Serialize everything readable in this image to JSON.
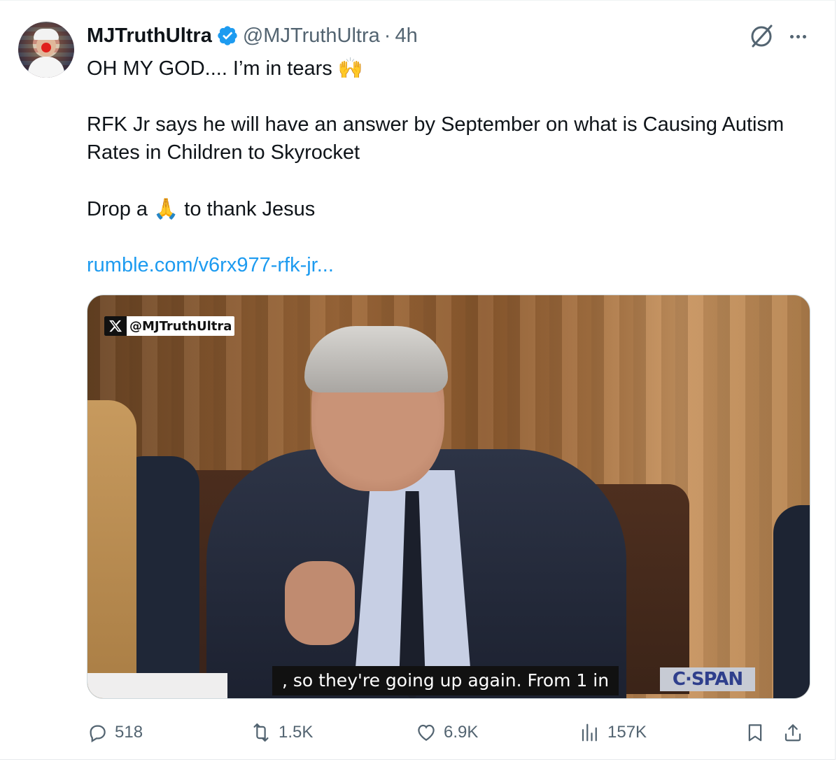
{
  "tweet": {
    "author_name": "MJTruthUltra",
    "handle": "@MJTruthUltra",
    "separator": "·",
    "time": "4h",
    "lines": {
      "line1": "OH MY GOD.... I’m in tears ",
      "line1_emoji": "🙌",
      "line2": "RFK Jr says he will have an answer by September on what is Causing Autism Rates in Children to Skyrocket",
      "line3_pre": "Drop a ",
      "line3_emoji": "🙏",
      "line3_post": " to thank Jesus",
      "link": "rumble.com/v6rx977-rfk-jr..."
    }
  },
  "media": {
    "watermark": "@MJTruthUltra",
    "caption": ", so they're going up again. From 1 in",
    "network_logo": "C·SPAN"
  },
  "actions": {
    "replies": "518",
    "reposts": "1.5K",
    "likes": "6.9K",
    "views": "157K"
  },
  "colors": {
    "link": "#1d9bf0",
    "muted": "#536471",
    "verified": "#1d9bf0"
  },
  "icons": [
    "verified-badge-icon",
    "grok-icon",
    "more-icon",
    "reply-icon",
    "repost-icon",
    "like-icon",
    "views-icon",
    "bookmark-icon",
    "share-icon",
    "x-logo-icon"
  ]
}
